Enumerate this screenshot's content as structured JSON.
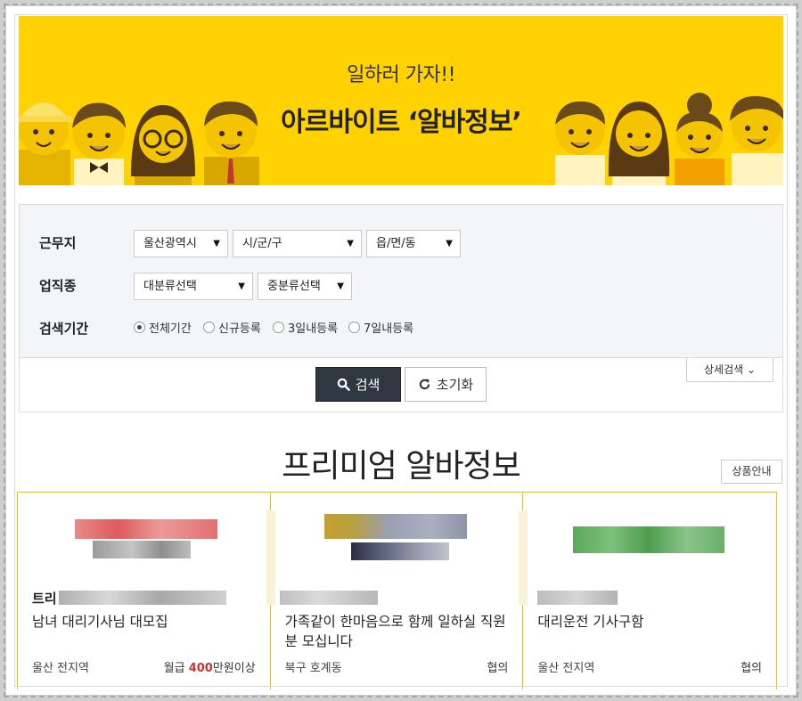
{
  "banner": {
    "subtitle": "일하러 가자!!",
    "title": "아르바이트 ‘알바정보’"
  },
  "search": {
    "rows": {
      "workplace_label": "근무지",
      "industry_label": "업직종",
      "period_label": "검색기간"
    },
    "workplace": {
      "city": "울산광역시",
      "district": "시/군/구",
      "town": "읍/면/동"
    },
    "industry": {
      "major": "대분류선택",
      "minor": "중분류선택"
    },
    "period_options": [
      {
        "label": "전체기간",
        "checked": true
      },
      {
        "label": "신규등록",
        "checked": false
      },
      {
        "label": "3일내등록",
        "checked": false
      },
      {
        "label": "7일내등록",
        "checked": false
      }
    ],
    "detail_label": "상세검색 ⌄",
    "search_label": "검색",
    "reset_label": "초기화"
  },
  "premium": {
    "title": "프리미엄 알바정보",
    "product_info_label": "상품안내",
    "cards": [
      {
        "company": "트리",
        "title": "남녀 대리기사님 대모집",
        "location": "울산 전지역",
        "pay_prefix": "월급 ",
        "pay_amount": "400",
        "pay_suffix": "만원이상"
      },
      {
        "company": "",
        "title": "가족같이 한마음으로 함께 일하실 직원분 모십니다",
        "location": "북구 호계동",
        "pay_prefix": "",
        "pay_amount": "",
        "pay_suffix": "협의"
      },
      {
        "company": "",
        "title": "대리운전 기사구함",
        "location": "울산 전지역",
        "pay_prefix": "",
        "pay_amount": "",
        "pay_suffix": "협의"
      }
    ]
  },
  "colors": {
    "banner_bg": "#ffd200",
    "search_btn": "#2f3740",
    "card_border": "#f0c000",
    "pay_highlight": "#c0392b"
  }
}
